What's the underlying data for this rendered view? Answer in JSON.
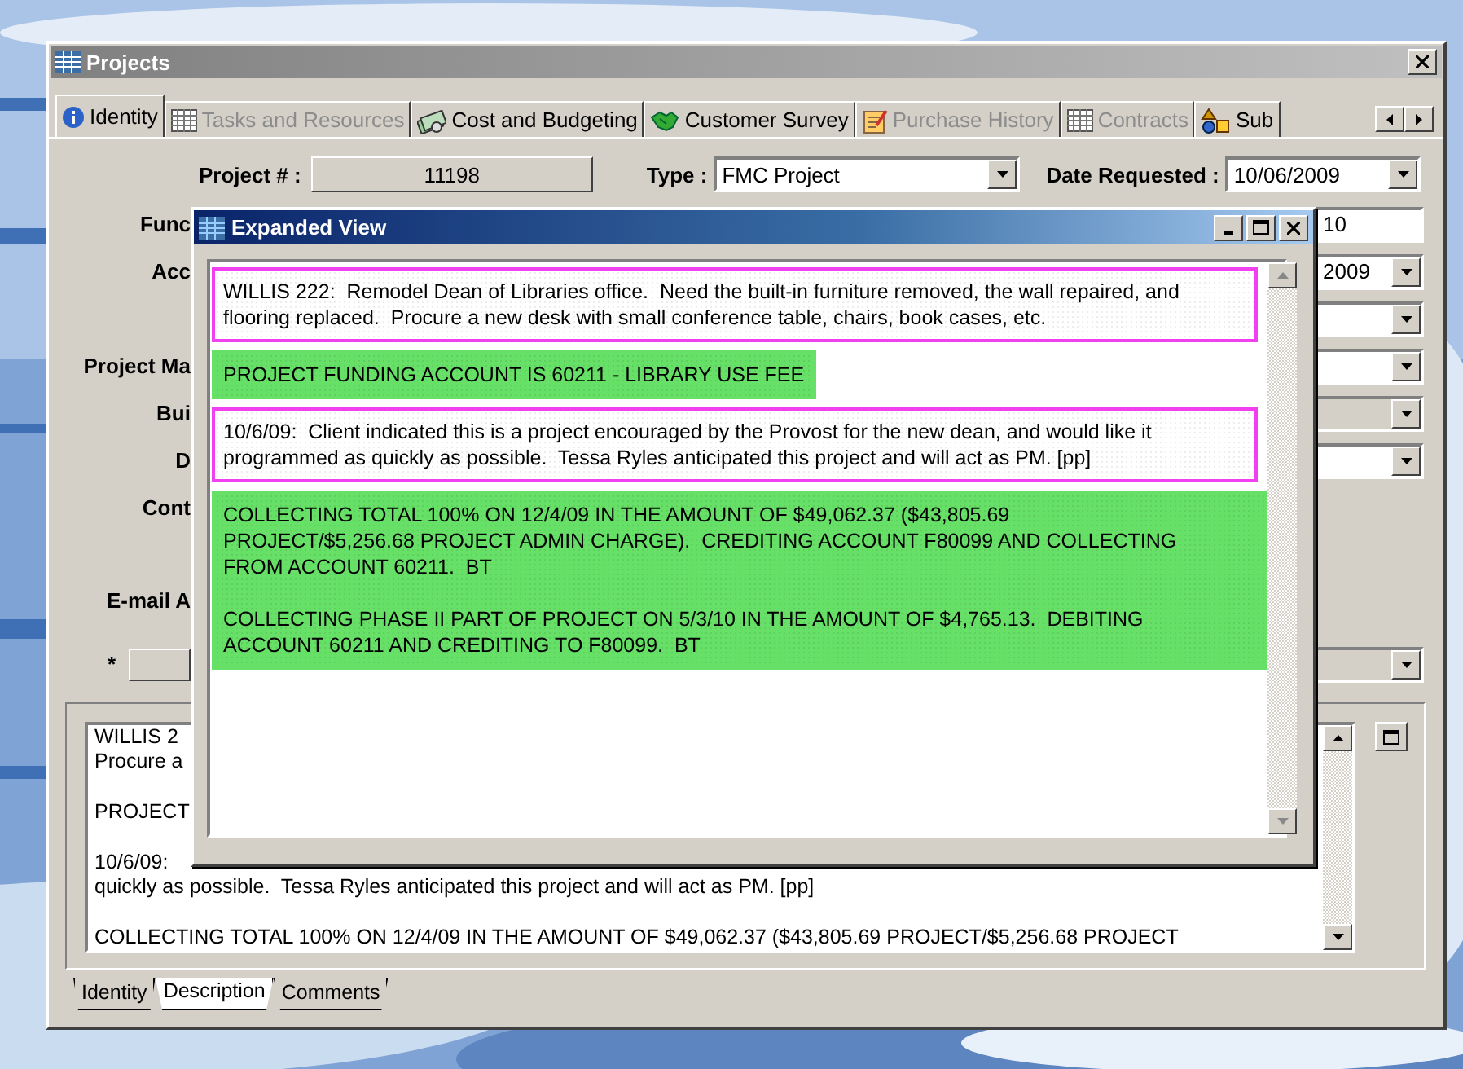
{
  "window": {
    "title": "Projects"
  },
  "tabs": [
    {
      "label": "Identity",
      "selected": true,
      "disabled": false
    },
    {
      "label": "Tasks and Resources",
      "selected": false,
      "disabled": true
    },
    {
      "label": "Cost and Budgeting",
      "selected": false,
      "disabled": false
    },
    {
      "label": "Customer Survey",
      "selected": false,
      "disabled": false
    },
    {
      "label": "Purchase History",
      "selected": false,
      "disabled": true
    },
    {
      "label": "Contracts",
      "selected": false,
      "disabled": true
    },
    {
      "label": "Sub",
      "selected": false,
      "disabled": false
    }
  ],
  "header_fields": [
    {
      "label": "Project # :",
      "value": "11198",
      "kind": "readonly"
    },
    {
      "label": "Type :",
      "value": "FMC Project",
      "kind": "dropdown"
    },
    {
      "label": "Date Requested :",
      "value": "10/06/2009",
      "kind": "dropdown"
    }
  ],
  "rows": [
    {
      "label": "Func",
      "kind": "label",
      "field": {
        "kind": "text",
        "value": "10",
        "disabled": false
      }
    },
    {
      "label": "Acc",
      "kind": "label",
      "field": {
        "kind": "dropdown",
        "value": "2009",
        "disabled": false
      }
    },
    {
      "kind": "label",
      "field": {
        "kind": "dropdown",
        "disabled": false
      }
    },
    {
      "label": "Project Ma",
      "kind": "label",
      "field": {
        "kind": "dropdown",
        "disabled": false
      }
    },
    {
      "label": "Bui",
      "kind": "label",
      "field": {
        "kind": "dropdown",
        "disabled": true
      }
    },
    {
      "label": "D",
      "kind": "label",
      "field": {
        "kind": "dropdown",
        "disabled": false
      }
    },
    {
      "label": "Cont",
      "kind": "label"
    },
    {
      "label": "E-mail A",
      "kind": "label"
    },
    {
      "label": "*",
      "kind": "button",
      "field": {
        "kind": "dropdown",
        "disabled": true
      }
    }
  ],
  "description": {
    "paragraphs": [
      [
        "WILLIS 2",
        "Procure a"
      ],
      [
        "PROJECT"
      ],
      [
        "10/6/09:",
        "quickly as possible.  Tessa Ryles anticipated this project and will act as PM. [pp]"
      ],
      [
        "COLLECTING TOTAL 100% ON 12/4/09 IN THE AMOUNT OF $49,062.37 ($43,805.69 PROJECT/$5,256.68 PROJECT"
      ]
    ]
  },
  "bottom_tabs": [
    {
      "label": "Identity",
      "selected": false
    },
    {
      "label": "Description",
      "selected": true
    },
    {
      "label": "Comments",
      "selected": false
    }
  ],
  "dialog": {
    "title": "Expanded View",
    "entries": [
      {
        "kind": "outlined",
        "color": "#f040f0",
        "paragraphs": [
          [
            "WILLIS 222:  Remodel Dean of Libraries office.  Need the built-in furniture removed, the wall repaired, and",
            "flooring replaced.  Procure a new desk with small conference table, chairs, book cases, etc."
          ]
        ]
      },
      {
        "kind": "filled",
        "color": "#66e066",
        "paragraphs": [
          [
            "PROJECT FUNDING ACCOUNT IS 60211 - LIBRARY USE FEE"
          ]
        ]
      },
      {
        "kind": "outlined",
        "color": "#f040f0",
        "paragraphs": [
          [
            "10/6/09:  Client indicated this is a project encouraged by the Provost for the new dean, and would like it",
            "programmed as quickly as possible.  Tessa Ryles anticipated this project and will act as PM. [pp]"
          ]
        ]
      },
      {
        "kind": "filled",
        "color": "#66e066",
        "paragraphs": [
          [
            "COLLECTING TOTAL 100% ON 12/4/09 IN THE AMOUNT OF $49,062.37 ($43,805.69",
            "PROJECT/$5,256.68 PROJECT ADMIN CHARGE).  CREDITING ACCOUNT F80099 AND COLLECTING",
            "FROM ACCOUNT 60211.  BT"
          ],
          [
            "COLLECTING PHASE II PART OF PROJECT ON 5/3/10 IN THE AMOUNT OF $4,765.13.  DEBITING",
            "ACCOUNT 60211 AND CREDITING TO F80099.  BT"
          ]
        ]
      }
    ]
  }
}
